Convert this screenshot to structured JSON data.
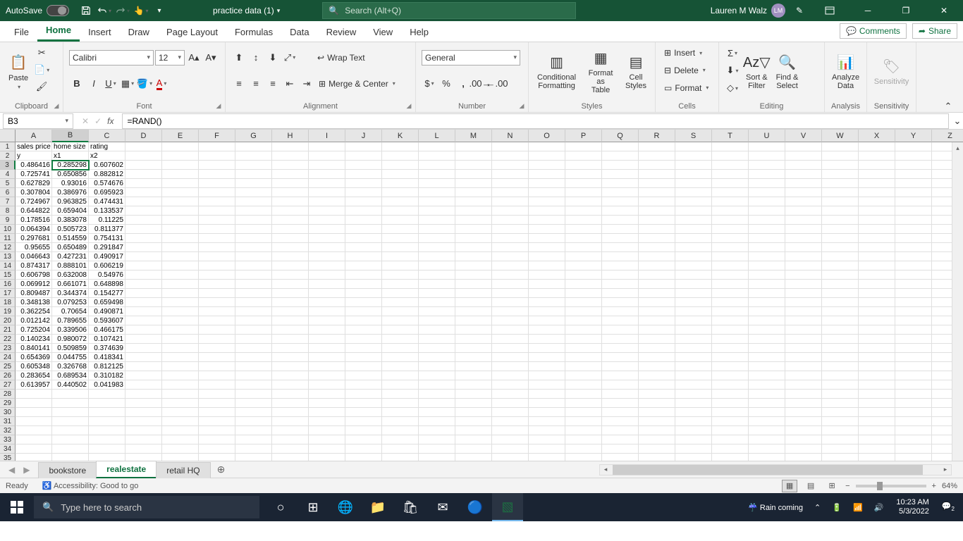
{
  "titlebar": {
    "autosave_label": "AutoSave",
    "autosave_state": "Off",
    "filename": "practice data (1)",
    "search_placeholder": "Search (Alt+Q)",
    "user_name": "Lauren M Walz",
    "user_initials": "LM"
  },
  "tabs": {
    "file": "File",
    "home": "Home",
    "insert": "Insert",
    "draw": "Draw",
    "page_layout": "Page Layout",
    "formulas": "Formulas",
    "data": "Data",
    "review": "Review",
    "view": "View",
    "help": "Help",
    "comments": "Comments",
    "share": "Share"
  },
  "ribbon": {
    "clipboard": {
      "paste": "Paste",
      "label": "Clipboard"
    },
    "font": {
      "name": "Calibri",
      "size": "12",
      "label": "Font"
    },
    "alignment": {
      "wrap": "Wrap Text",
      "merge": "Merge & Center",
      "label": "Alignment"
    },
    "number": {
      "format": "General",
      "label": "Number"
    },
    "styles": {
      "cond": "Conditional\nFormatting",
      "table": "Format as\nTable",
      "cell": "Cell\nStyles",
      "label": "Styles"
    },
    "cells": {
      "insert": "Insert",
      "delete": "Delete",
      "format": "Format",
      "label": "Cells"
    },
    "editing": {
      "sort": "Sort &\nFilter",
      "find": "Find &\nSelect",
      "label": "Editing"
    },
    "analysis": {
      "analyze": "Analyze\nData",
      "label": "Analysis"
    },
    "sensitivity": {
      "btn": "Sensitivity",
      "label": "Sensitivity"
    }
  },
  "namebox": "B3",
  "formula": "=RAND()",
  "columns": [
    "A",
    "B",
    "C",
    "D",
    "E",
    "F",
    "G",
    "H",
    "I",
    "J",
    "K",
    "L",
    "M",
    "N",
    "O",
    "P",
    "Q",
    "R",
    "S",
    "T",
    "U",
    "V",
    "W",
    "X",
    "Y",
    "Z"
  ],
  "active_cell": {
    "row": 3,
    "col": "B"
  },
  "rows": [
    {
      "n": 1,
      "A": "sales price",
      "B": "home size",
      "C": "rating"
    },
    {
      "n": 2,
      "A": "y",
      "B": "x1",
      "C": "x2"
    },
    {
      "n": 3,
      "A": "0.486416",
      "B": "0.285298",
      "C": "0.607602"
    },
    {
      "n": 4,
      "A": "0.725741",
      "B": "0.650856",
      "C": "0.882812"
    },
    {
      "n": 5,
      "A": "0.627829",
      "B": "0.93016",
      "C": "0.574676"
    },
    {
      "n": 6,
      "A": "0.307804",
      "B": "0.386976",
      "C": "0.695923"
    },
    {
      "n": 7,
      "A": "0.724967",
      "B": "0.963825",
      "C": "0.474431"
    },
    {
      "n": 8,
      "A": "0.644822",
      "B": "0.659404",
      "C": "0.133537"
    },
    {
      "n": 9,
      "A": "0.178516",
      "B": "0.383078",
      "C": "0.11225"
    },
    {
      "n": 10,
      "A": "0.064394",
      "B": "0.505723",
      "C": "0.811377"
    },
    {
      "n": 11,
      "A": "0.297681",
      "B": "0.514559",
      "C": "0.754131"
    },
    {
      "n": 12,
      "A": "0.95655",
      "B": "0.650489",
      "C": "0.291847"
    },
    {
      "n": 13,
      "A": "0.046643",
      "B": "0.427231",
      "C": "0.490917"
    },
    {
      "n": 14,
      "A": "0.874317",
      "B": "0.888101",
      "C": "0.606219"
    },
    {
      "n": 15,
      "A": "0.606798",
      "B": "0.632008",
      "C": "0.54976"
    },
    {
      "n": 16,
      "A": "0.069912",
      "B": "0.661071",
      "C": "0.648898"
    },
    {
      "n": 17,
      "A": "0.809487",
      "B": "0.344374",
      "C": "0.154277"
    },
    {
      "n": 18,
      "A": "0.348138",
      "B": "0.079253",
      "C": "0.659498"
    },
    {
      "n": 19,
      "A": "0.362254",
      "B": "0.70654",
      "C": "0.490871"
    },
    {
      "n": 20,
      "A": "0.012142",
      "B": "0.789655",
      "C": "0.593607"
    },
    {
      "n": 21,
      "A": "0.725204",
      "B": "0.339506",
      "C": "0.466175"
    },
    {
      "n": 22,
      "A": "0.140234",
      "B": "0.980072",
      "C": "0.107421"
    },
    {
      "n": 23,
      "A": "0.840141",
      "B": "0.509859",
      "C": "0.374639"
    },
    {
      "n": 24,
      "A": "0.654369",
      "B": "0.044755",
      "C": "0.418341"
    },
    {
      "n": 25,
      "A": "0.605348",
      "B": "0.326768",
      "C": "0.812125"
    },
    {
      "n": 26,
      "A": "0.283654",
      "B": "0.689534",
      "C": "0.310182"
    },
    {
      "n": 27,
      "A": "0.613957",
      "B": "0.440502",
      "C": "0.041983"
    },
    {
      "n": 28
    },
    {
      "n": 29
    },
    {
      "n": 30
    },
    {
      "n": 31
    },
    {
      "n": 32
    },
    {
      "n": 33
    },
    {
      "n": 34
    },
    {
      "n": 35
    }
  ],
  "sheets": {
    "bookstore": "bookstore",
    "realestate": "realestate",
    "retail": "retail HQ"
  },
  "status": {
    "ready": "Ready",
    "access": "Accessibility: Good to go",
    "zoom": "64%"
  },
  "taskbar": {
    "search": "Type here to search",
    "weather": "Rain coming",
    "time": "10:23 AM",
    "date": "5/3/2022",
    "notif_count": "2"
  }
}
